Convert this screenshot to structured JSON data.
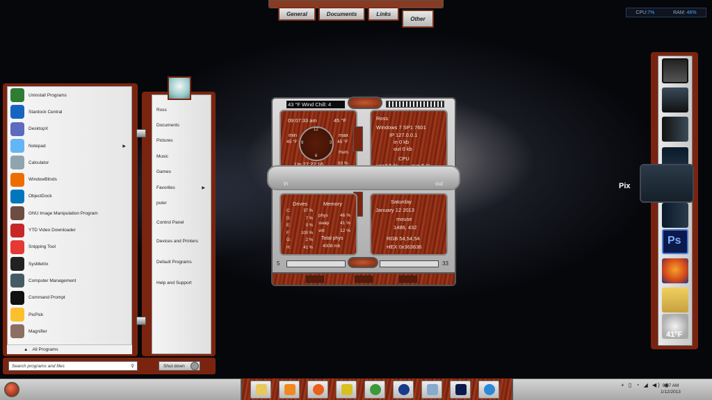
{
  "top_tabs": [
    "General",
    "Documents",
    "Links",
    "Other"
  ],
  "meter": {
    "cpu_label": "CPU:",
    "cpu_value": "7%",
    "ram_label": "RAM:",
    "ram_value": "46%"
  },
  "start_menu": {
    "programs": [
      {
        "label": "Uninstall Programs",
        "icon": "uninstall-icon",
        "color": "#2e7d32"
      },
      {
        "label": "Stardock Central",
        "icon": "stardock-icon",
        "color": "#1565c0"
      },
      {
        "label": "DesktopX",
        "icon": "desktopx-icon",
        "color": "#5c6bc0"
      },
      {
        "label": "Notepad",
        "icon": "notepad-icon",
        "color": "#64b5f6",
        "arrow": "▶"
      },
      {
        "label": "Calculator",
        "icon": "calculator-icon",
        "color": "#90a4ae"
      },
      {
        "label": "WindowBlinds",
        "icon": "windowblinds-icon",
        "color": "#ef6c00"
      },
      {
        "label": "ObjectDock",
        "icon": "objectdock-icon",
        "color": "#0277bd"
      },
      {
        "label": "GNU Image Manipulation Program",
        "icon": "gimp-icon",
        "color": "#6d4c41"
      },
      {
        "label": "YTD Video Downloader",
        "icon": "ytd-icon",
        "color": "#c62828"
      },
      {
        "label": "Snipping Tool",
        "icon": "snipping-tool-icon",
        "color": "#e53935"
      },
      {
        "label": "SysMetrix",
        "icon": "sysmetrix-icon",
        "color": "#212121"
      },
      {
        "label": "Computer Management",
        "icon": "computer-management-icon",
        "color": "#455a64"
      },
      {
        "label": "Command Prompt",
        "icon": "command-prompt-icon",
        "color": "#111111"
      },
      {
        "label": "PicPick",
        "icon": "picpick-icon",
        "color": "#fbc02d"
      },
      {
        "label": "Magnifier",
        "icon": "magnifier-icon",
        "color": "#8d6e63"
      }
    ],
    "all_programs": "All Programs",
    "all_programs_arrow": "▲",
    "right_items": [
      "Ross",
      "Documents",
      "Pictures",
      "Music",
      "Games",
      "Favorites",
      "puter",
      "Control Panel",
      "Devices and Printers",
      "Default Programs",
      "Help and Support"
    ],
    "favorites_arrow": "▶",
    "search_placeholder": "Search programs and files",
    "search_icon": "⚲",
    "shutdown_label": "Shut down"
  },
  "widget": {
    "weather_text": "43 °F   Wind Chill: 4",
    "time": "09:07:33 am",
    "temp_right": "45 °F",
    "min_label": "min",
    "min_value": "45 °F",
    "max_label": "max",
    "max_value": "45 °F",
    "hum_label": "Hum.",
    "clock_numbers": [
      "12",
      "3",
      "6",
      "9"
    ],
    "uptime": "Up 27:22:16",
    "humidity": "93 %",
    "user": "Ross",
    "os": "Windows 7  SP1     7601",
    "ip": "IP  127.0.0.1",
    "net_in": "in 0  kb",
    "net_out": "out 0 kb",
    "cpu_title": "CPU",
    "cpu_used": "used 5 %",
    "cpu_ave": "ave 5 %",
    "drives_title": "Drives",
    "drives": [
      {
        "d": "C:",
        "v": "37 %"
      },
      {
        "d": "D:",
        "v": "7 %"
      },
      {
        "d": "E:",
        "v": "0 %"
      },
      {
        "d": "F:",
        "v": "100 %"
      },
      {
        "d": "G:",
        "v": "2 %"
      },
      {
        "d": "H:",
        "v": "41 %"
      }
    ],
    "memory_title": "Memory",
    "memory": [
      {
        "k": "phys",
        "v": "46 %"
      },
      {
        "k": "swap",
        "v": "41 %"
      },
      {
        "k": "virt",
        "v": "12 %"
      }
    ],
    "total_phys_label": "Total phys",
    "total_phys_value": "4008 mb",
    "day": "Saturday",
    "date": "January    12    2013",
    "mouse_label": "mouse",
    "mouse_pos": "1486, 432",
    "rgb": "RGB  54,54,54",
    "hex": "HEX  0x363636",
    "in_label": "in",
    "out_label": "out",
    "slider_low": "5",
    "slider_high": "33"
  },
  "dock": {
    "popup_label": "Pix",
    "weather_temp": "41°F"
  },
  "taskbar": {
    "apps": [
      "explorer-icon",
      "media-player-icon",
      "firefox-icon",
      "xchat-icon",
      "chrome-icon",
      "stardock-icon",
      "notepad-icon",
      "photoshop-icon",
      "internet-explorer-icon"
    ],
    "tray": "+  ▯ ◔ ◢ ◀) ◉",
    "time": "9:07 AM",
    "date": "1/12/2013"
  }
}
